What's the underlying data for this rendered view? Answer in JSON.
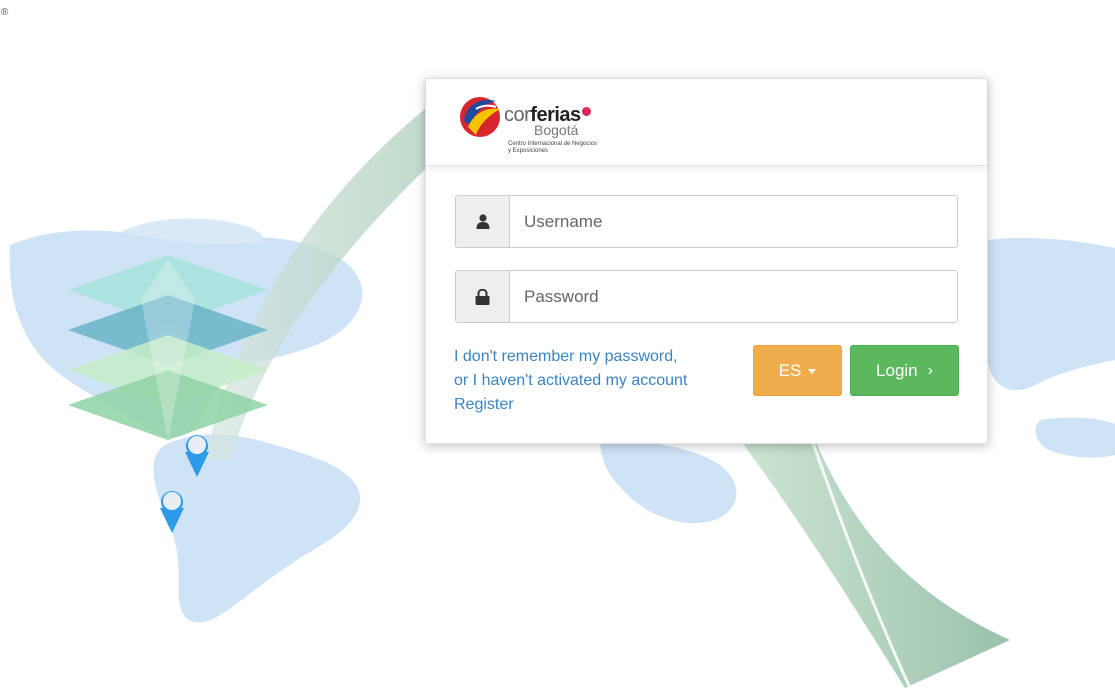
{
  "brand": {
    "registered_mark": "®",
    "logo_word_light": "cor",
    "logo_word_bold": "ferias",
    "logo_city": "Bogotá",
    "logo_tagline": "Centro Internacional de Negocios y Exposiciones"
  },
  "login_form": {
    "username_placeholder": "Username",
    "password_placeholder": "Password",
    "forgot_line1": "I don't remember my password,",
    "forgot_line2": "or I haven't activated my account",
    "register_label": "Register",
    "language_button_label": "ES",
    "login_button_label": "Login",
    "login_button_chevron": "›"
  },
  "icons": {
    "username": "user-icon",
    "password": "lock-icon",
    "language": "caret-down-icon",
    "login": "chevron-right-icon"
  },
  "colors": {
    "login_button": "#5cb85c",
    "language_button": "#f0ad4e",
    "link": "#3a84c4",
    "map_fill": "#cfe3f6",
    "arc_fill": "#b8d9c6"
  }
}
